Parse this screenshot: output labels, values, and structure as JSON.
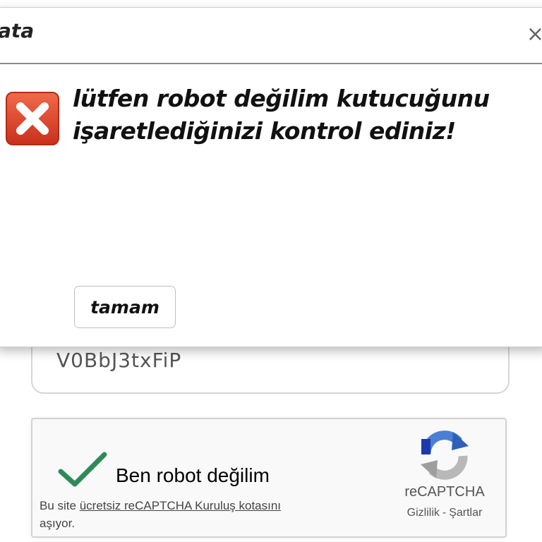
{
  "dialog": {
    "title": "ata",
    "close_glyph": "×",
    "message": "lütfen robot değilim kutucuğunu işaretlediğinizi kontrol ediniz!",
    "ok_label": "tamam",
    "error_icon": "error-x-icon",
    "error_color": "#d9432b"
  },
  "form": {
    "code_value": "V0BbJ3txFiP"
  },
  "recaptcha": {
    "checkbox_label": "Ben robot değilim",
    "quota_prefix": "Bu site ",
    "quota_link": "ücretsiz reCAPTCHA Kuruluş kotasını",
    "quota_suffix": " aşıyor.",
    "brand": "reCAPTCHA",
    "privacy_link": "Gizlilik",
    "separator": "-",
    "terms_link": "Şartlar",
    "check_color": "#2e8b57",
    "logo_icon": "recaptcha-logo-icon"
  }
}
